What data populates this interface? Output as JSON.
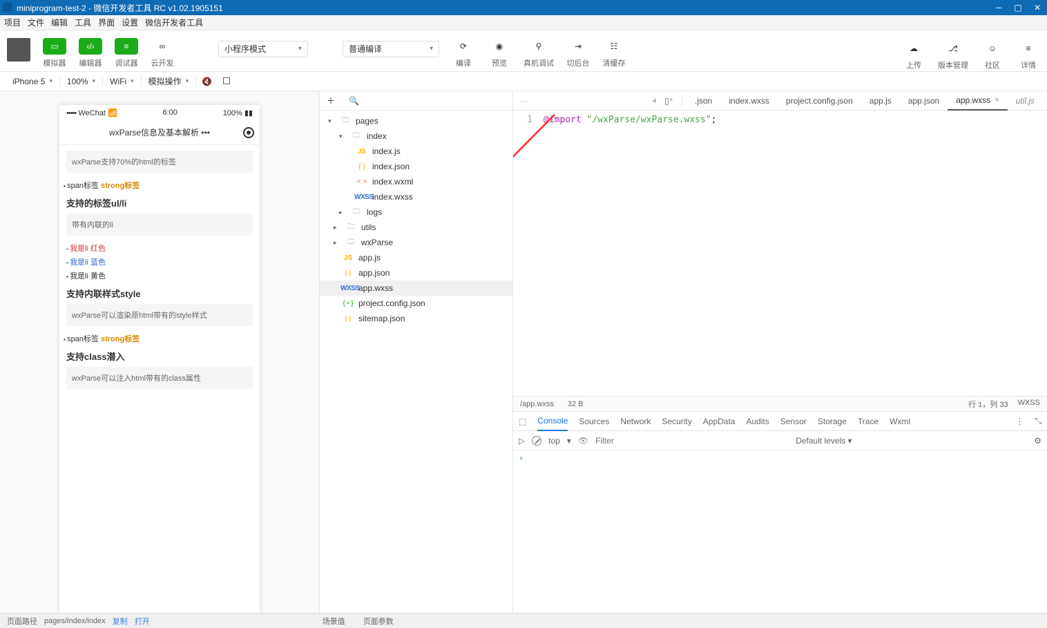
{
  "window": {
    "title": "miniprogram-test-2 - 微信开发者工具 RC v1.02.1905151"
  },
  "menubar": [
    "项目",
    "文件",
    "编辑",
    "工具",
    "界面",
    "设置",
    "微信开发者工具"
  ],
  "toolbar": {
    "simulator": "模拟器",
    "editor": "编辑器",
    "debugger": "调试器",
    "cloud": "云开发",
    "mode": "小程序模式",
    "compileModeLabel": "普通编译",
    "compile": "编译",
    "preview": "预览",
    "remote": "真机调试",
    "background": "切后台",
    "clearCache": "清缓存",
    "upload": "上传",
    "version": "版本管理",
    "community": "社区",
    "detail": "详情"
  },
  "simToolbar": {
    "device": "iPhone 5",
    "zoom": "100%",
    "network": "WiFi",
    "simOps": "模拟操作"
  },
  "phone": {
    "carrier": "WeChat",
    "signalDots": "•••••",
    "time": "6:00",
    "battery": "100%",
    "navTitle": "wxParse信息及基本解析",
    "body": {
      "box1": "wxParse支持70%的html的标签",
      "spanLine1a": "span标签 ",
      "spanLine1b": "strong标签",
      "h1": "支持的标签ul/li",
      "box2": "带有内联的li",
      "li1": "我是li 红色",
      "li2": "我是li 蓝色",
      "li3": "我是li 黄色",
      "h2": "支持内联样式style",
      "box3": "wxParse可以渲染原html带有的style样式",
      "spanLine2a": "span标签 ",
      "spanLine2b": "strong标签",
      "h3": "支持class潜入",
      "box4": "wxParse可以注入html带有的class属性"
    }
  },
  "tree": {
    "pages": "pages",
    "index": "index",
    "indexjs": "index.js",
    "indexjson": "index.json",
    "indexwxml": "index.wxml",
    "indexwxss": "index.wxss",
    "logs": "logs",
    "utils": "utils",
    "wxParse": "wxParse",
    "appjs": "app.js",
    "appjson": "app.json",
    "appwxss": "app.wxss",
    "projectconfig": "project.config.json",
    "sitemap": "sitemap.json"
  },
  "tabs": {
    "json": ".json",
    "indexwxss": "index.wxss",
    "projectconfig": "project.config.json",
    "appjs": "app.js",
    "appjson": "app.json",
    "appwxss": "app.wxss",
    "utiljs": "util.js"
  },
  "code": {
    "lineNo": "1",
    "kw": "@import",
    "str": "\"/wxParse/wxParse.wxss\"",
    "semi": ";"
  },
  "editorStatus": {
    "path": "/app.wxss",
    "size": "32 B",
    "cursor": "行 1，列 33",
    "lang": "WXSS"
  },
  "devtools": {
    "tabs": [
      "Console",
      "Sources",
      "Network",
      "Security",
      "AppData",
      "Audits",
      "Sensor",
      "Storage",
      "Trace",
      "Wxml"
    ],
    "contextTop": "top",
    "filterPlaceholder": "Filter",
    "levels": "Default levels ▾",
    "prompt": "›"
  },
  "footer": {
    "pathLabel": "页面路径",
    "pathValue": "pages/index/index",
    "copy": "复制",
    "open": "打开",
    "scene": "场景值",
    "pageParams": "页面参数"
  }
}
